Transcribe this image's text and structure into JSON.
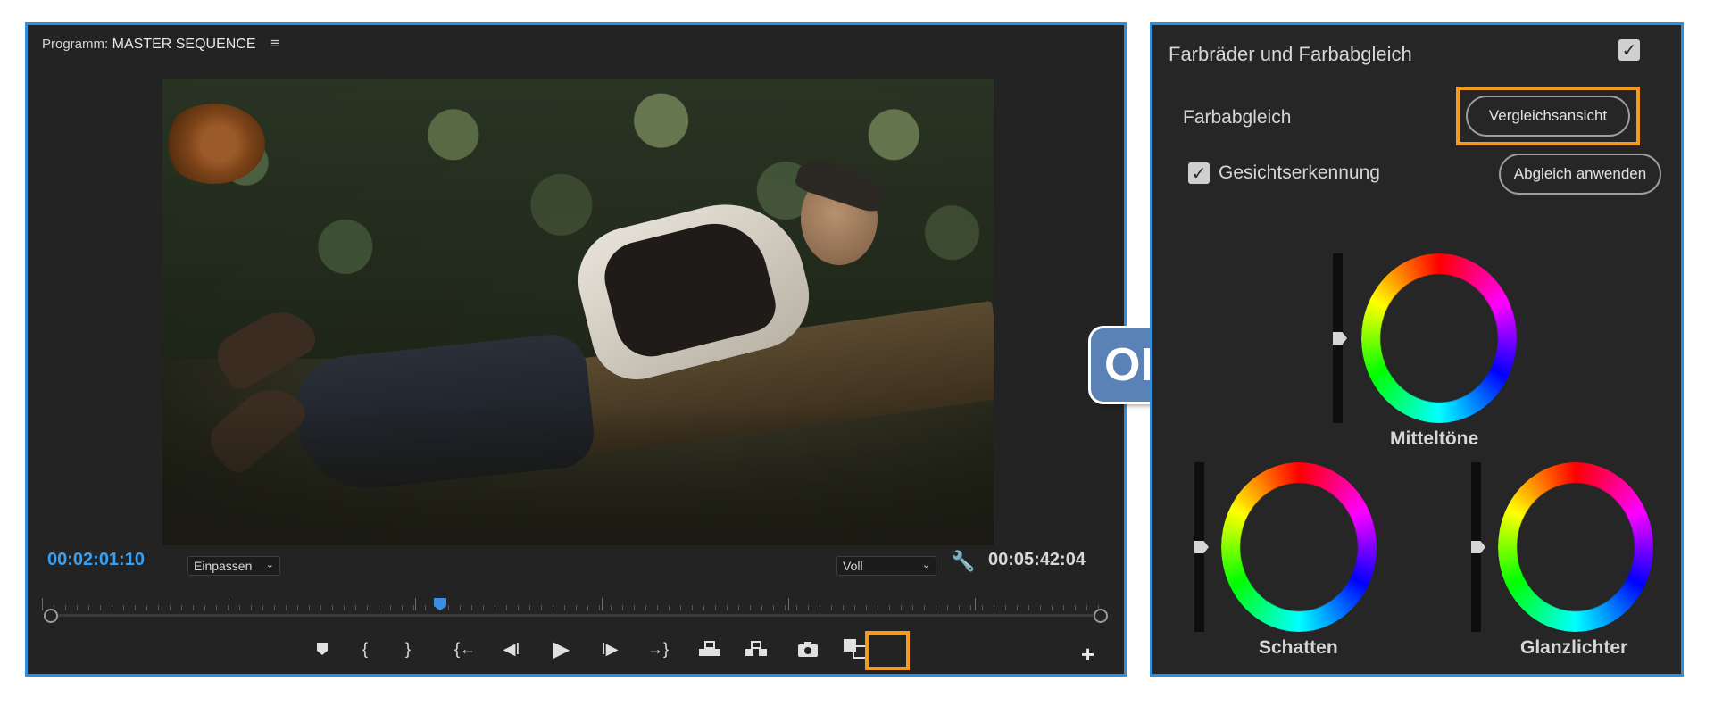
{
  "program_monitor": {
    "label_prefix": "Programm:",
    "sequence_name": "MASTER SEQUENCE",
    "current_time": "00:02:01:10",
    "duration": "00:05:42:04",
    "zoom_select": "Einpassen",
    "quality_select": "Voll"
  },
  "or_badge": "OR",
  "color_panel": {
    "title": "Farbräder und Farbabgleich",
    "match_label": "Farbabgleich",
    "compare_view_button": "Vergleichsansicht",
    "face_detection_label": "Gesichtserkennung",
    "apply_match_button": "Abgleich anwenden",
    "wheels": {
      "midtones": "Mitteltöne",
      "shadows": "Schatten",
      "highlights": "Glanzlichter"
    }
  },
  "colors": {
    "accent_blue": "#2f8fdc",
    "highlight_orange": "#f39a1f",
    "timecode_blue": "#3a9ff0",
    "panel_bg": "#232323"
  }
}
